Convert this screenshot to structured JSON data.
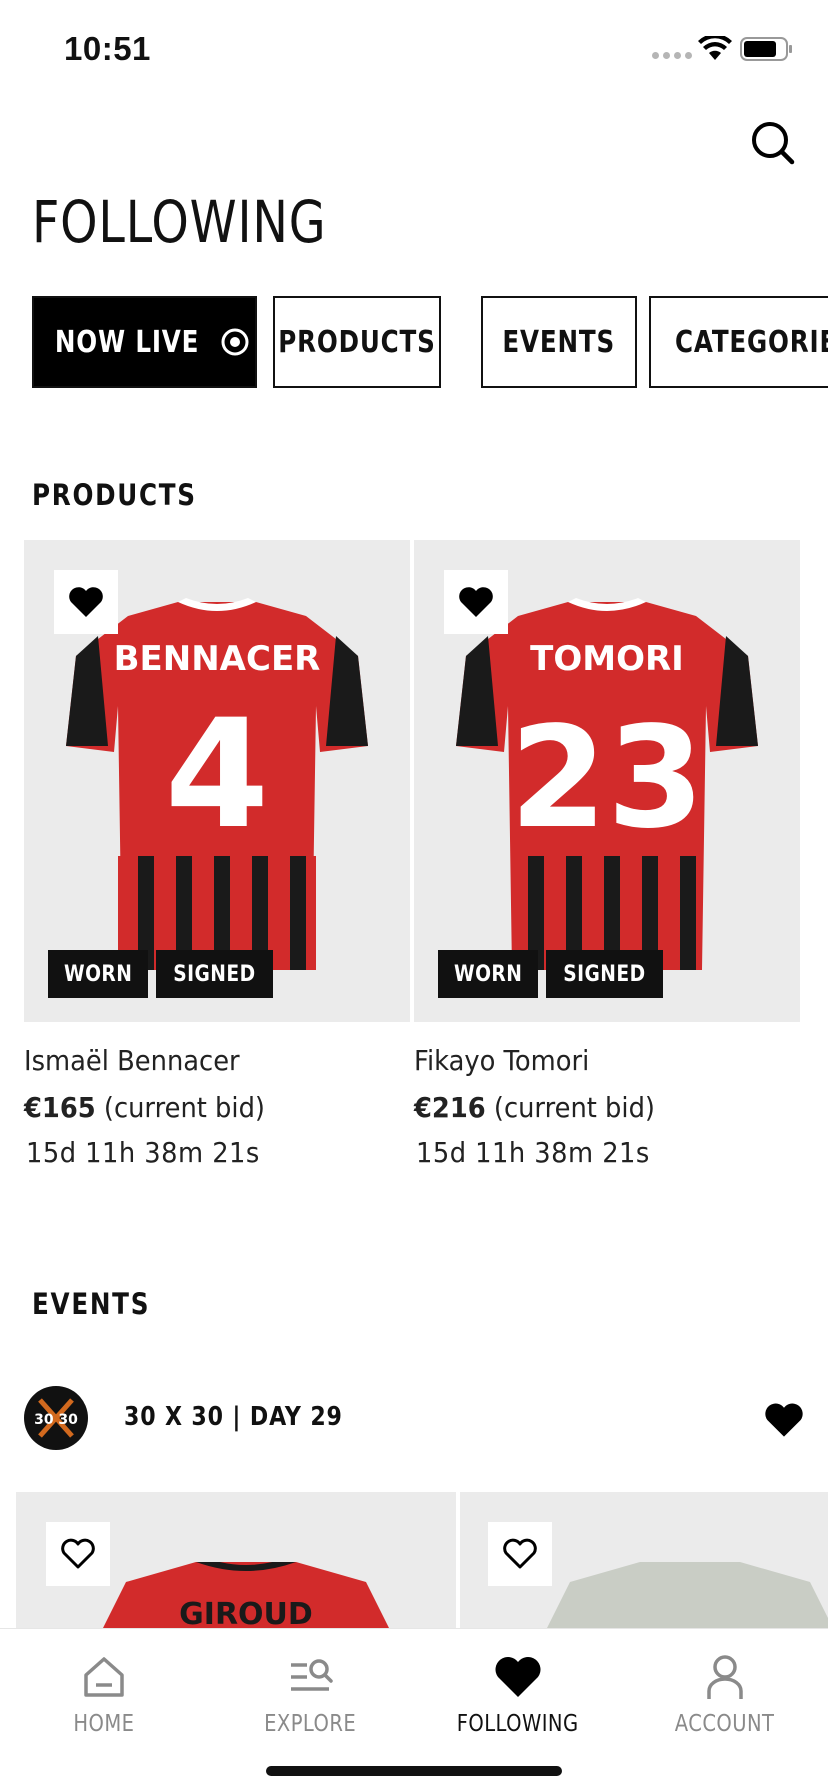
{
  "status_bar": {
    "time": "10:51"
  },
  "page": {
    "title": "FOLLOWING"
  },
  "tabs": [
    {
      "label": "NOW LIVE",
      "active": true
    },
    {
      "label": "PRODUCTS",
      "active": false
    },
    {
      "label": "EVENTS",
      "active": false
    },
    {
      "label": "CATEGORIES",
      "active": false
    }
  ],
  "products_section": {
    "title": "PRODUCTS",
    "items": [
      {
        "name": "Ismaël Bennacer",
        "jersey_name": "BENNACER",
        "jersey_number": "4",
        "price": "€165",
        "price_suffix": "(current bid)",
        "timer": "15d 11h 38m 21s",
        "badges": [
          "WORN",
          "SIGNED"
        ],
        "favorited": true
      },
      {
        "name": "Fikayo Tomori",
        "jersey_name": "TOMORI",
        "jersey_number": "23",
        "price": "€216",
        "price_suffix": "(current bid)",
        "timer": "15d 11h 38m 21s",
        "badges": [
          "WORN",
          "SIGNED"
        ],
        "favorited": true
      }
    ]
  },
  "events_section": {
    "title": "EVENTS",
    "event": {
      "name": "30 X 30 | DAY 29",
      "avatar_text": "30 30",
      "favorited": true
    },
    "preview_cards": [
      {
        "jersey_name": "GIROUD",
        "favorited": false
      },
      {
        "jersey_name": "",
        "favorited": false
      }
    ]
  },
  "bottom_nav": [
    {
      "label": "HOME",
      "icon": "home-icon",
      "active": false
    },
    {
      "label": "EXPLORE",
      "icon": "explore-icon",
      "active": false
    },
    {
      "label": "FOLLOWING",
      "icon": "heart-icon",
      "active": true
    },
    {
      "label": "ACCOUNT",
      "icon": "account-icon",
      "active": false
    }
  ],
  "colors": {
    "jersey_red": "#d22b2b",
    "jersey_black": "#1a1a1a",
    "card_bg": "#ebebeb",
    "inactive_nav": "#8a8a8a"
  }
}
